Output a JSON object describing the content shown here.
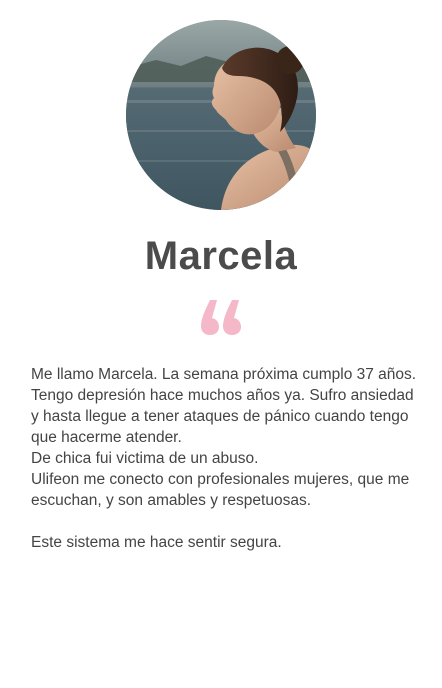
{
  "profile": {
    "name": "Marcela"
  },
  "testimonial": {
    "lines": [
      "Me llamo Marcela. La semana próxima cumplo 37 años.",
      "Tengo depresión hace muchos años ya. Sufro ansiedad y hasta llegue a tener ataques de pánico cuando tengo que hacerme atender.",
      "De chica fui victima de un abuso.",
      "Ulifeon me conecto con profesionales mujeres, que me escuchan, y son amables y respetuosas.",
      "Este sistema me hace sentir segura."
    ]
  },
  "colors": {
    "quote_mark": "#f4b8c8",
    "name_text": "#4b4b4b",
    "body_text": "#444444"
  },
  "icons": {
    "quote": "quote-icon"
  }
}
